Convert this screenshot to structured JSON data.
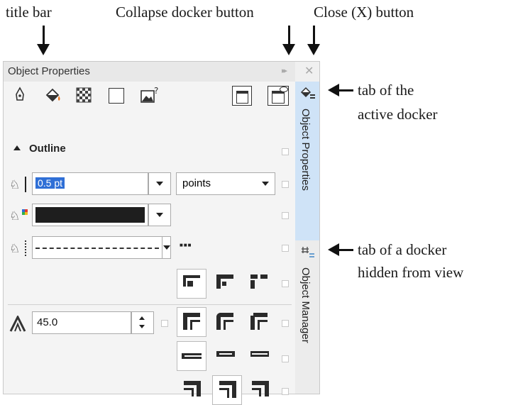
{
  "annotations": {
    "title_bar": "title bar",
    "collapse_button": "Collapse docker button",
    "close_button": "Close (X) button",
    "active_tab_line1": "tab of the",
    "active_tab_line2": "active docker",
    "hidden_tab_line1": "tab of a docker",
    "hidden_tab_line2": "hidden from view"
  },
  "docker": {
    "title": "Object Properties",
    "collapse_glyph": "▸▸",
    "close_glyph": "✕",
    "toolbar_icons": [
      "outline-pen-icon",
      "fill-bucket-icon",
      "transparency-icon",
      "frame-icon",
      "image-properties-icon"
    ],
    "toolbar_right_icons": [
      "window-icon",
      "view-settings-icon"
    ],
    "section_title": "Outline",
    "width_value": "0.5 pt",
    "units_value": "points",
    "color_value": "#1e1e1e",
    "angle_value": "45.0",
    "line_style_more": "■■■"
  },
  "tabs": {
    "active": "Object Properties",
    "hidden": "Object Manager"
  },
  "colors": {
    "accent": "#5aa0e0",
    "active_tab": "#cfe3f7",
    "selection": "#2f6fd6"
  }
}
